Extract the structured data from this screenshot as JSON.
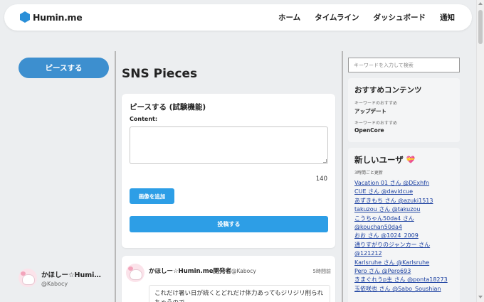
{
  "header": {
    "logo_text": "Humin.me",
    "nav": [
      "ホーム",
      "タイムライン",
      "ダッシュボード",
      "通知"
    ]
  },
  "left": {
    "piece_button": "ピースする",
    "profile_name": "かほしー☆Humi…",
    "profile_handle": "@Kabocy"
  },
  "main": {
    "page_title": "SNS Pieces",
    "compose": {
      "title": "ピースする (試験機能)",
      "content_label": "Content:",
      "char_count": "140",
      "add_image": "画像を追加",
      "post_button": "投稿する"
    },
    "post": {
      "author": "かほしー☆Humin.me開発者",
      "handle": "@Kabocy",
      "time": "5時間前",
      "body": "これだけ暑い日が続くとどれだけ体力あってもジリジリ削られちゃうので…"
    }
  },
  "sidebar": {
    "search_placeholder": "キーワードを入力して検索",
    "recommended": {
      "title": "おすすめコンテンツ",
      "items": [
        {
          "sub": "キーワードのおすすめ",
          "name": "アップデート"
        },
        {
          "sub": "キーワードのおすすめ",
          "name": "OpenCore"
        }
      ]
    },
    "new_users": {
      "title": "新しいユーザ",
      "subtitle": "3時間ごと更新",
      "users": [
        "Vacation 01 さん @DExhfn",
        "CUE さん @davidcue",
        "あずきもち さん @azuki1513",
        "takuzou さん @takuzou",
        "こうちゃん50da4 さん",
        "@kouchan50da4",
        "おお さん @1024_2009",
        "通りすがりのジャンカー さん",
        "@121212",
        "Karlsruhe さん @Karlsruhe",
        "Pero さん @Pero693",
        "きまぐれうp主 さん @ponta18273",
        "玉依咲也 さん @Sabo_Soushian"
      ]
    }
  },
  "colors": {
    "accent_blue": "#2d9ee6",
    "piece_button": "#3d8fcf",
    "logo": "#2a8fd8",
    "link": "#1a3fa0"
  }
}
